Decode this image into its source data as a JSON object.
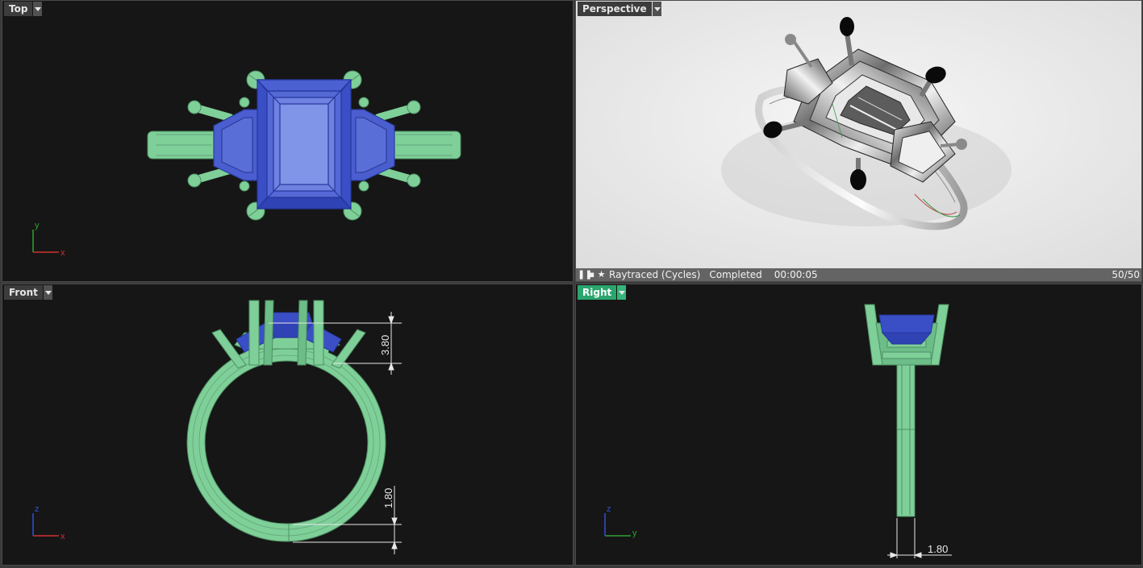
{
  "viewports": {
    "top": {
      "label": "Top",
      "axis_x": "x",
      "axis_y": "y"
    },
    "perspective": {
      "label": "Perspective",
      "status": {
        "mode": "Raytraced (Cycles)",
        "state": "Completed",
        "elapsed": "00:00:05",
        "passes": "50/50"
      }
    },
    "front": {
      "label": "Front",
      "axis_x": "x",
      "axis_z": "z",
      "dimensions": [
        "3.80",
        "1.80"
      ]
    },
    "right": {
      "label": "Right",
      "axis_y": "y",
      "axis_z": "z",
      "dimensions": [
        "1.80"
      ]
    }
  },
  "colors": {
    "active_tab": "#2aa56e",
    "metal": "#7fcf98",
    "gem": "#3450c8",
    "background": "#161616"
  }
}
